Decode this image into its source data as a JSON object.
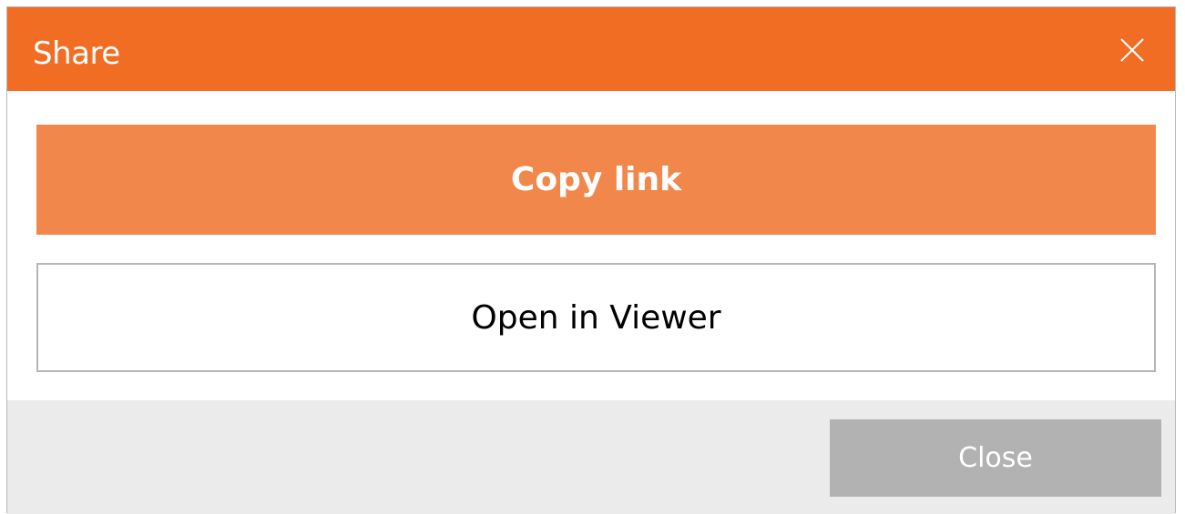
{
  "dialog": {
    "title": "Share",
    "close_icon": "close-icon"
  },
  "actions": {
    "copy_link_label": "Copy link",
    "open_viewer_label": "Open in Viewer"
  },
  "footer": {
    "close_label": "Close"
  },
  "colors": {
    "titlebar": "#f26d24",
    "primary_button": "#f2874b",
    "footer_background": "#ebebeb",
    "close_button": "#b2b2b2"
  }
}
